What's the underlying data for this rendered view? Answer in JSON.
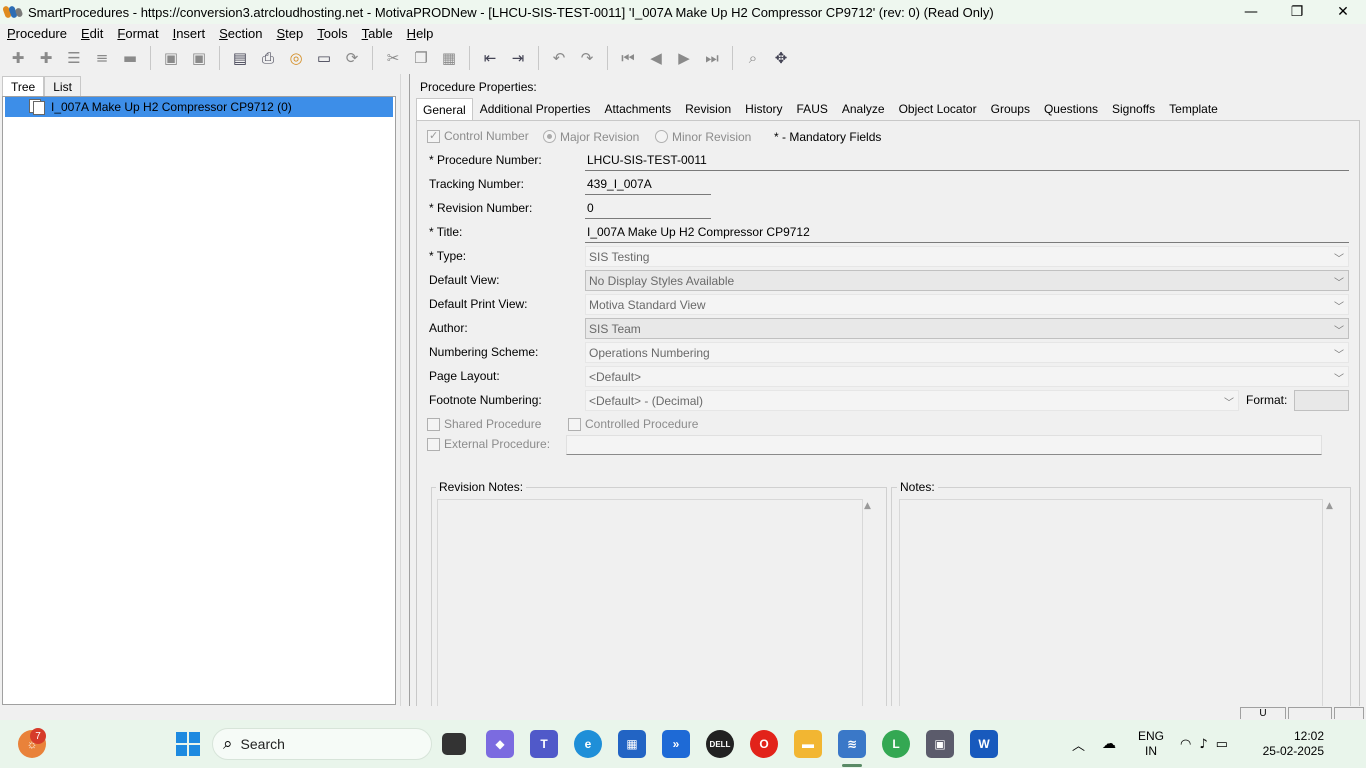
{
  "window": {
    "title": "SmartProcedures - https://conversion3.atrcloudhosting.net - MotivaPRODNew - [LHCU-SIS-TEST-0011] 'I_007A Make Up H2 Compressor CP9712' (rev: 0) (Read Only)",
    "controls": {
      "minimize": "—",
      "restore": "❐",
      "close": "✕"
    }
  },
  "menu": {
    "items": [
      {
        "label": "Procedure",
        "u": "P",
        "rest": "rocedure"
      },
      {
        "label": "Edit",
        "u": "E",
        "rest": "dit"
      },
      {
        "label": "Format",
        "u": "F",
        "rest": "ormat"
      },
      {
        "label": "Insert",
        "u": "I",
        "rest": "nsert"
      },
      {
        "label": "Section",
        "u": "S",
        "rest": "ection"
      },
      {
        "label": "Step",
        "u": "S",
        "rest": "tep"
      },
      {
        "label": "Tools",
        "u": "T",
        "rest": "ools"
      },
      {
        "label": "Table",
        "u": "T",
        "rest": "able"
      },
      {
        "label": "Help",
        "u": "H",
        "rest": "elp"
      }
    ]
  },
  "left_panel": {
    "tabs": [
      "Tree",
      "List"
    ],
    "active_tab": "Tree",
    "tree_item": "I_007A Make Up H2 Compressor CP9712 (0)"
  },
  "right_panel": {
    "header": "Procedure Properties:",
    "tabs": [
      "General",
      "Additional Properties",
      "Attachments",
      "Revision",
      "History",
      "FAUS",
      "Analyze",
      "Object Locator",
      "Groups",
      "Questions",
      "Signoffs",
      "Template"
    ],
    "active_tab": "General",
    "options": {
      "control_number": "Control Number",
      "major_revision": "Major Revision",
      "minor_revision": "Minor Revision",
      "mandatory_note": "* - Mandatory Fields"
    },
    "fields": {
      "procedure_number": {
        "label": "* Procedure Number:",
        "value": "LHCU-SIS-TEST-0011"
      },
      "tracking_number": {
        "label": "Tracking Number:",
        "value": "439_I_007A"
      },
      "revision_number": {
        "label": "* Revision Number:",
        "value": "0"
      },
      "title": {
        "label": "* Title:",
        "value": "I_007A Make Up H2 Compressor CP9712"
      },
      "type": {
        "label": "* Type:",
        "value": "SIS Testing"
      },
      "default_view": {
        "label": "Default View:",
        "value": "No Display Styles Available"
      },
      "default_print_view": {
        "label": "Default Print View:",
        "value": "Motiva Standard View"
      },
      "author": {
        "label": "Author:",
        "value": "SIS Team"
      },
      "numbering_scheme": {
        "label": "Numbering Scheme:",
        "value": "Operations Numbering"
      },
      "page_layout": {
        "label": "Page Layout:",
        "value": "<Default>"
      },
      "footnote_numbering": {
        "label": "Footnote Numbering:",
        "value": "<Default> - (Decimal)"
      },
      "format": {
        "label": "Format:",
        "value": ""
      }
    },
    "checkboxes": {
      "shared": "Shared Procedure",
      "controlled": "Controlled Procedure",
      "external": "External Procedure:"
    },
    "revision_notes_label": "Revision Notes:",
    "notes_label": "Notes:"
  },
  "statusbar": {
    "segment1": "U"
  },
  "taskbar": {
    "search_placeholder": "Search",
    "notification_count": "7",
    "lang_line1": "ENG",
    "lang_line2": "IN",
    "time": "12:02",
    "date": "25-02-2025",
    "chrome_badge": "L"
  }
}
